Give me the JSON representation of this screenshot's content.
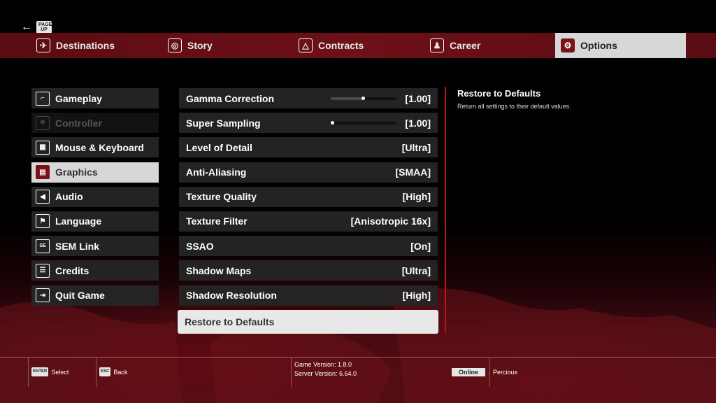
{
  "nav": {
    "back_key": "PAGE UP",
    "tabs": [
      {
        "label": "Destinations",
        "icon": "airplane-icon"
      },
      {
        "label": "Story",
        "icon": "globe-icon"
      },
      {
        "label": "Contracts",
        "icon": "contracts-icon"
      },
      {
        "label": "Career",
        "icon": "career-icon"
      },
      {
        "label": "Options",
        "icon": "gear-icon",
        "active": true
      }
    ]
  },
  "menu": [
    {
      "label": "Gameplay",
      "icon": "gun-icon"
    },
    {
      "label": "Controller",
      "icon": "controller-icon",
      "disabled": true
    },
    {
      "label": "Mouse & Keyboard",
      "icon": "keyboard-icon"
    },
    {
      "label": "Graphics",
      "icon": "monitor-icon",
      "active": true
    },
    {
      "label": "Audio",
      "icon": "speaker-icon"
    },
    {
      "label": "Language",
      "icon": "flag-icon"
    },
    {
      "label": "SEM Link",
      "icon": "sem-icon"
    },
    {
      "label": "Credits",
      "icon": "credits-icon"
    },
    {
      "label": "Quit Game",
      "icon": "exit-icon"
    }
  ],
  "settings": [
    {
      "label": "Gamma Correction",
      "value": "[1.00]",
      "slider": 0.5
    },
    {
      "label": "Super Sampling",
      "value": "[1.00]",
      "slider": 0.0
    },
    {
      "label": "Level of Detail",
      "value": "[Ultra]"
    },
    {
      "label": "Anti-Aliasing",
      "value": "[SMAA]"
    },
    {
      "label": "Texture Quality",
      "value": "[High]"
    },
    {
      "label": "Texture Filter",
      "value": "[Anisotropic 16x]"
    },
    {
      "label": "SSAO",
      "value": "[On]"
    },
    {
      "label": "Shadow Maps",
      "value": "[Ultra]"
    },
    {
      "label": "Shadow Resolution",
      "value": "[High]"
    },
    {
      "label": "Restore to Defaults",
      "value": "",
      "selected": true
    }
  ],
  "description": {
    "title": "Restore to Defaults",
    "body": "Return all settings to their default values."
  },
  "footer": {
    "select_key": "ENTER",
    "select_label": "Select",
    "back_key": "ESC",
    "back_label": "Back",
    "game_version": "Game Version: 1.8.0",
    "server_version": "Server Version: 6.64.0",
    "status": "Online",
    "username": "Percious"
  },
  "colors": {
    "accent_red": "#7a1118",
    "tab_bar": "#6e1017",
    "scroll_red": "#c0101c"
  }
}
